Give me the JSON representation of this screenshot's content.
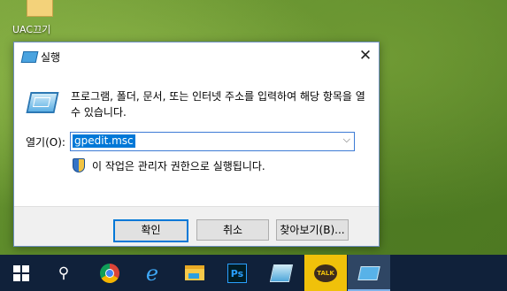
{
  "desktop": {
    "icon_label": "UAC끄기"
  },
  "dialog": {
    "title": "실행",
    "close_glyph": "✕",
    "description": "프로그램, 폴더, 문서, 또는 인터넷 주소를 입력하여 해당 항목을 열 수 있습니다.",
    "open_label": "열기(O):",
    "open_value": "gpedit.msc",
    "dropdown_glyph": "⌵",
    "admin_note": "이 작업은 관리자 권한으로 실행됩니다.",
    "buttons": {
      "ok": "확인",
      "cancel": "취소",
      "browse": "찾아보기(B)..."
    }
  },
  "taskbar": {
    "search_glyph": "⚲",
    "ie_glyph": "e",
    "photoshop_text": "Ps",
    "kakaotalk_text": "TALK",
    "icons": [
      "windows-start-icon",
      "search-icon",
      "chrome-icon",
      "internet-explorer-icon",
      "file-explorer-icon",
      "photoshop-icon",
      "glass-app-icon",
      "kakaotalk-icon",
      "run-icon"
    ]
  },
  "colors": {
    "accent": "#0078d7",
    "taskbar": "#10213a",
    "dialog_footer": "#f0f0f0"
  }
}
